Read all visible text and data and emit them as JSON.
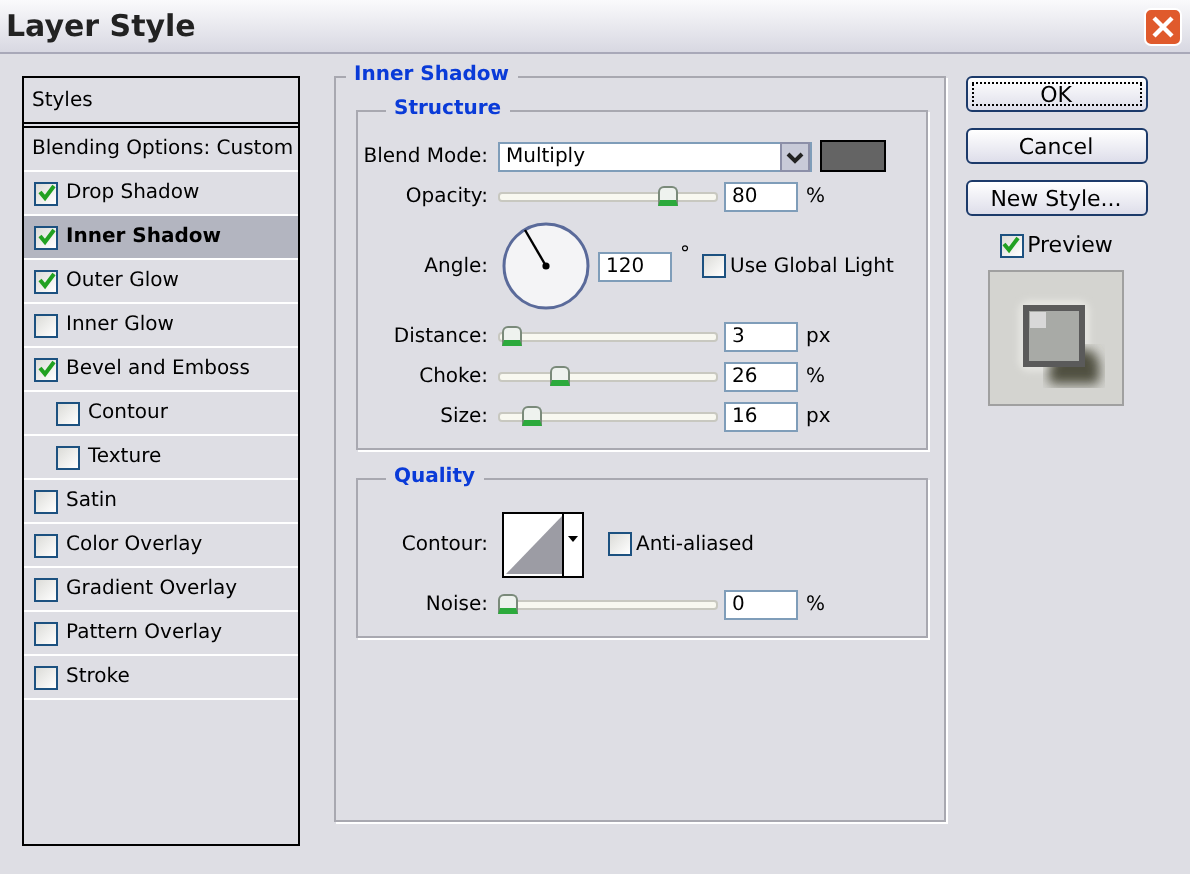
{
  "window": {
    "title": "Layer Style"
  },
  "sidebar": {
    "header": "Styles",
    "options": "Blending Options: Custom",
    "items": [
      {
        "label": "Drop Shadow",
        "checked": true,
        "selected": false
      },
      {
        "label": "Inner Shadow",
        "checked": true,
        "selected": true
      },
      {
        "label": "Outer Glow",
        "checked": true,
        "selected": false
      },
      {
        "label": "Inner Glow",
        "checked": false,
        "selected": false
      },
      {
        "label": "Bevel and Emboss",
        "checked": true,
        "selected": false,
        "children": [
          {
            "label": "Contour",
            "checked": false,
            "selected": false
          },
          {
            "label": "Texture",
            "checked": false,
            "selected": false
          }
        ]
      },
      {
        "label": "Satin",
        "checked": false,
        "selected": false
      },
      {
        "label": "Color Overlay",
        "checked": false,
        "selected": false
      },
      {
        "label": "Gradient Overlay",
        "checked": false,
        "selected": false
      },
      {
        "label": "Pattern Overlay",
        "checked": false,
        "selected": false
      },
      {
        "label": "Stroke",
        "checked": false,
        "selected": false
      }
    ]
  },
  "panel": {
    "title": "Inner Shadow",
    "structure": {
      "title": "Structure",
      "blend_label": "Blend Mode:",
      "blend_value": "Multiply",
      "color": "#646464",
      "opacity": {
        "label": "Opacity:",
        "level": 0.8,
        "value": "80",
        "unit": "%"
      },
      "angle": {
        "label": "Angle:",
        "value": "120",
        "unit": "°",
        "global_label": "Use Global Light",
        "global_checked": false
      },
      "sliders": [
        {
          "label": "Distance:",
          "level": 0.02,
          "value": "3",
          "unit": "px"
        },
        {
          "label": "Choke:",
          "level": 0.26,
          "value": "26",
          "unit": "%"
        },
        {
          "label": "Size:",
          "level": 0.12,
          "value": "16",
          "unit": "px"
        }
      ]
    },
    "quality": {
      "title": "Quality",
      "contour_label": "Contour:",
      "anti_label": "Anti-aliased",
      "anti_checked": false,
      "noise": {
        "label": "Noise:",
        "level": 0,
        "value": "0",
        "unit": "%"
      }
    }
  },
  "buttons": [
    "OK",
    "Cancel",
    "New Style..."
  ],
  "preview": {
    "label": "Preview",
    "checked": true
  }
}
